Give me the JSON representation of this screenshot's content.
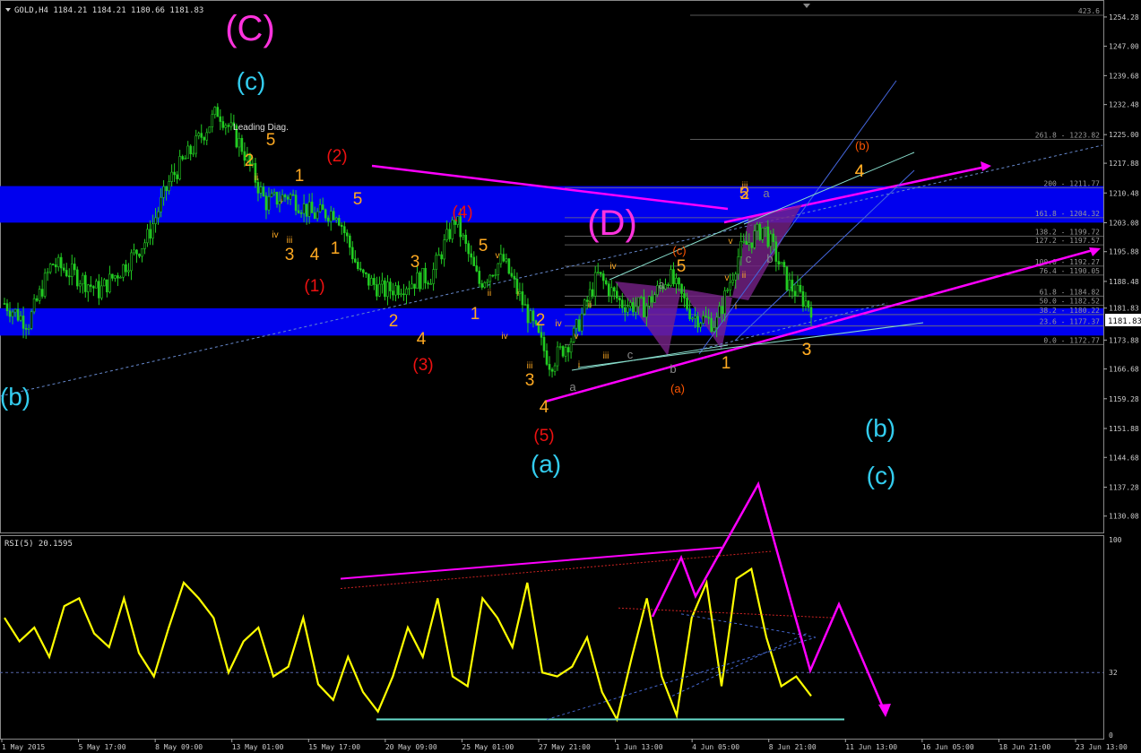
{
  "window": {
    "symbol_header": "GOLD,H4  1184.21 1184.21 1180.66 1181.83",
    "current_price": "1181.83",
    "rsi_header": "RSI(5) 20.1595"
  },
  "colors": {
    "background": "#000000",
    "candles": "#22cc22",
    "zone": "#0000ee",
    "rsi_line": "#ffff00",
    "magenta": "#ff00ff",
    "cyan_label": "#33ccee",
    "orange_label": "#ffaa22",
    "red_label": "#ee1111"
  },
  "chart_data": [
    {
      "type": "candlestick",
      "title": "GOLD,H4",
      "price_axis_ticks": [
        "1254.28",
        "1247.00",
        "1239.68",
        "1232.48",
        "1225.00",
        "1217.88",
        "1210.48",
        "1203.08",
        "1195.88",
        "1188.48",
        "1181.83",
        "1173.88",
        "1166.68",
        "1159.28",
        "1151.88",
        "1144.68",
        "1137.28",
        "1130.08"
      ],
      "time_axis_ticks": [
        "1 May 2015",
        "5 May 17:00",
        "8 May 09:00",
        "13 May 01:00",
        "15 May 17:00",
        "20 May 09:00",
        "25 May 01:00",
        "27 May 21:00",
        "1 Jun 13:00",
        "4 Jun 05:00",
        "8 Jun 21:00",
        "11 Jun 13:00",
        "16 Jun 05:00",
        "18 Jun 21:00",
        "23 Jun 13:00"
      ],
      "ylim": [
        1126.0,
        1258.5
      ],
      "approx_close_path": [
        {
          "x": "1 May 2015",
          "y": 1183
        },
        {
          "x": "4 May",
          "y": 1178
        },
        {
          "x": "5 May 17:00",
          "y": 1193
        },
        {
          "x": "7 May",
          "y": 1190
        },
        {
          "x": "8 May 09:00",
          "y": 1186
        },
        {
          "x": "11 May",
          "y": 1192
        },
        {
          "x": "12 May",
          "y": 1199
        },
        {
          "x": "13 May 01:00",
          "y": 1214
        },
        {
          "x": "14 May",
          "y": 1222
        },
        {
          "x": "15 May 17:00",
          "y": 1231
        },
        {
          "x": "18 May",
          "y": 1222
        },
        {
          "x": "19 May",
          "y": 1208
        },
        {
          "x": "20 May 09:00",
          "y": 1210
        },
        {
          "x": "21 May",
          "y": 1205
        },
        {
          "x": "22 May",
          "y": 1206
        },
        {
          "x": "25 May 01:00",
          "y": 1190
        },
        {
          "x": "26 May",
          "y": 1186
        },
        {
          "x": "27 May 21:00",
          "y": 1188
        },
        {
          "x": "28 May",
          "y": 1190
        },
        {
          "x": "29 May",
          "y": 1204
        },
        {
          "x": "1 Jun 13:00",
          "y": 1188
        },
        {
          "x": "2 Jun",
          "y": 1194
        },
        {
          "x": "3 Jun",
          "y": 1181
        },
        {
          "x": "4 Jun 05:00",
          "y": 1168
        },
        {
          "x": "5 Jun",
          "y": 1175
        },
        {
          "x": "8 Jun 21:00",
          "y": 1190
        },
        {
          "x": "9 Jun",
          "y": 1183
        },
        {
          "x": "10 Jun",
          "y": 1182
        },
        {
          "x": "11 Jun 13:00",
          "y": 1190
        },
        {
          "x": "12 Jun",
          "y": 1180
        },
        {
          "x": "16 Jun 05:00",
          "y": 1178
        },
        {
          "x": "17 Jun",
          "y": 1196
        },
        {
          "x": "18 Jun 21:00",
          "y": 1202
        },
        {
          "x": "19 Jun",
          "y": 1188
        },
        {
          "x": "23 Jun 13:00",
          "y": 1182
        }
      ],
      "fib_levels": [
        {
          "label": "423.6",
          "value": 1254.7
        },
        {
          "label": "261.8 - 1223.82",
          "value": 1223.82
        },
        {
          "label": "200 - 1211.77",
          "value": 1211.77
        },
        {
          "label": "161.8 - 1204.32",
          "value": 1204.32
        },
        {
          "label": "138.2 - 1199.72",
          "value": 1199.72
        },
        {
          "label": "127.2 - 1197.57",
          "value": 1197.57
        },
        {
          "label": "100.0 - 1192.27",
          "value": 1192.27
        },
        {
          "label": "76.4 - 1190.05",
          "value": 1190.05
        },
        {
          "label": "61.8 - 1184.82",
          "value": 1184.82
        },
        {
          "label": "50.0 - 1182.52",
          "value": 1182.52
        },
        {
          "label": "38.2 - 1180.22",
          "value": 1180.22
        },
        {
          "label": "23.6 - 1177.37",
          "value": 1177.37
        },
        {
          "label": "0.0 - 1172.77",
          "value": 1172.77
        }
      ],
      "zones": [
        {
          "name": "upper resistance zone",
          "from": 1203.1,
          "to": 1212.2
        },
        {
          "name": "lower support zone",
          "from": 1175.0,
          "to": 1181.8
        }
      ],
      "annotations": [
        {
          "text": "(C)",
          "color": "#ff33dd",
          "size": "xl"
        },
        {
          "text": "(c)",
          "color": "#33ccee",
          "size": "l"
        },
        {
          "text": "(b)",
          "color": "#33ccee",
          "size": "l"
        },
        {
          "text": "(2)",
          "color": "#ee1111",
          "size": "m"
        },
        {
          "text": "(4)",
          "color": "#ee1111",
          "size": "m"
        },
        {
          "text": "(1)",
          "color": "#ee1111",
          "size": "m"
        },
        {
          "text": "(3)",
          "color": "#ee1111",
          "size": "m"
        },
        {
          "text": "(5)",
          "color": "#ee1111",
          "size": "m"
        },
        {
          "text": "(a)",
          "color": "#33ccee",
          "size": "l"
        },
        {
          "text": "(b)",
          "color": "#33ccee",
          "size": "l"
        },
        {
          "text": "(c)",
          "color": "#33ccee",
          "size": "l"
        },
        {
          "text": "(D)",
          "color": "#ff33dd",
          "size": "xl"
        },
        {
          "text": "(a)",
          "color": "#ff5500",
          "size": "s"
        },
        {
          "text": "(b)",
          "color": "#ff5500",
          "size": "s"
        },
        {
          "text": "(c)",
          "color": "#ff5500",
          "size": "s"
        },
        {
          "text": "Leading Diag.",
          "color": "#dddddd",
          "size": "xs"
        },
        {
          "text": "2",
          "color": "#ffaa22",
          "size": "m"
        },
        {
          "text": "1",
          "color": "#ffaa22",
          "size": "m"
        },
        {
          "text": "3",
          "color": "#ffaa22",
          "size": "m"
        },
        {
          "text": "4",
          "color": "#ffaa22",
          "size": "m"
        },
        {
          "text": "5",
          "color": "#ffaa22",
          "size": "m"
        },
        {
          "text": "1",
          "color": "#ffaa22",
          "size": "m"
        },
        {
          "text": "2",
          "color": "#ffaa22",
          "size": "m"
        },
        {
          "text": "3",
          "color": "#ffaa22",
          "size": "m"
        },
        {
          "text": "4",
          "color": "#ffaa22",
          "size": "m"
        },
        {
          "text": "5",
          "color": "#ffaa22",
          "size": "m"
        },
        {
          "text": "1",
          "color": "#ffaa22",
          "size": "m"
        },
        {
          "text": "2",
          "color": "#ffaa22",
          "size": "m"
        },
        {
          "text": "3",
          "color": "#ffaa22",
          "size": "m"
        },
        {
          "text": "4",
          "color": "#ffaa22",
          "size": "m"
        },
        {
          "text": "5",
          "color": "#ffaa22",
          "size": "m"
        },
        {
          "text": "1",
          "color": "#ffaa22",
          "size": "m"
        },
        {
          "text": "2",
          "color": "#ffaa22",
          "size": "m"
        },
        {
          "text": "3",
          "color": "#ffaa22",
          "size": "m"
        },
        {
          "text": "4",
          "color": "#ffaa22",
          "size": "m"
        },
        {
          "text": "5",
          "color": "#ffaa22",
          "size": "m"
        },
        {
          "text": "3",
          "color": "#ffaa22",
          "size": "m"
        },
        {
          "text": "4",
          "color": "#ffaa22",
          "size": "m"
        },
        {
          "text": "5",
          "color": "#ffaa22",
          "size": "m"
        },
        {
          "text": "ii",
          "color": "#ffaa22",
          "size": "xs"
        },
        {
          "text": "i",
          "color": "#ffaa22",
          "size": "xs"
        },
        {
          "text": "iv",
          "color": "#ffaa22",
          "size": "xs"
        },
        {
          "text": "iii",
          "color": "#ffaa22",
          "size": "xs"
        },
        {
          "text": "v",
          "color": "#ffaa22",
          "size": "xs"
        },
        {
          "text": "ii",
          "color": "#ffaa22",
          "size": "xs"
        },
        {
          "text": "i",
          "color": "#ffaa22",
          "size": "xs"
        },
        {
          "text": "iv",
          "color": "#ffaa22",
          "size": "xs"
        },
        {
          "text": "iii",
          "color": "#ffaa22",
          "size": "xs"
        },
        {
          "text": "v",
          "color": "#ffaa22",
          "size": "xs"
        },
        {
          "text": "i",
          "color": "#ffaa22",
          "size": "xs"
        },
        {
          "text": "ii",
          "color": "#ffaa22",
          "size": "xs"
        },
        {
          "text": "iii",
          "color": "#ffaa22",
          "size": "xs"
        },
        {
          "text": "iv",
          "color": "#ffaa22",
          "size": "xs"
        },
        {
          "text": "v",
          "color": "#ffaa22",
          "size": "xs"
        },
        {
          "text": "iii",
          "color": "#ffaa22",
          "size": "xs"
        },
        {
          "text": "v",
          "color": "#ffaa22",
          "size": "xs"
        },
        {
          "text": "i",
          "color": "#ffaa22",
          "size": "xs"
        },
        {
          "text": "ii",
          "color": "#ffaa22",
          "size": "xs"
        },
        {
          "text": "iv",
          "color": "#ffaa22",
          "size": "xs"
        },
        {
          "text": "a",
          "color": "#888888",
          "size": "s"
        },
        {
          "text": "b",
          "color": "#888888",
          "size": "s"
        },
        {
          "text": "c",
          "color": "#888888",
          "size": "s"
        },
        {
          "text": "a",
          "color": "#888888",
          "size": "s"
        },
        {
          "text": "b",
          "color": "#888888",
          "size": "s"
        },
        {
          "text": "c",
          "color": "#888888",
          "size": "s"
        },
        {
          "text": "a",
          "color": "#888888",
          "size": "s"
        },
        {
          "text": "b",
          "color": "#888888",
          "size": "s"
        }
      ]
    },
    {
      "type": "line",
      "title": "RSI(5) 20.1595",
      "y_axis_ticks": [
        "100",
        "32",
        "0"
      ],
      "ylim": [
        0,
        100
      ],
      "level": 32,
      "last_value": 20.1595,
      "approx_values": [
        60,
        48,
        55,
        40,
        66,
        70,
        52,
        45,
        70,
        42,
        30,
        55,
        78,
        70,
        60,
        32,
        48,
        55,
        30,
        35,
        60,
        26,
        18,
        40,
        22,
        12,
        30,
        55,
        40,
        70,
        30,
        25,
        70,
        60,
        45,
        78,
        32,
        30,
        35,
        50,
        22,
        8,
        40,
        70,
        30,
        10,
        60,
        78,
        25,
        80,
        85,
        50,
        25,
        30,
        20
      ]
    }
  ]
}
